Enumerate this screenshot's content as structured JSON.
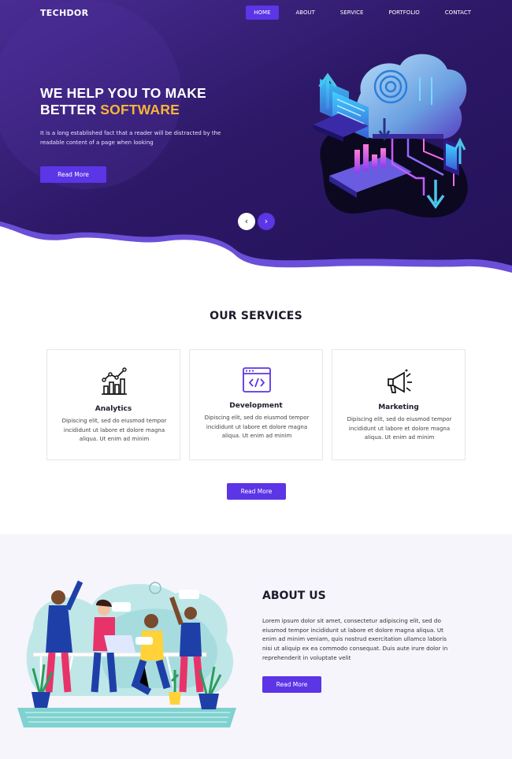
{
  "nav": {
    "logo": "TECHDOR",
    "items": [
      {
        "label": "HOME",
        "active": true
      },
      {
        "label": "ABOUT",
        "active": false
      },
      {
        "label": "SERVICE",
        "active": false
      },
      {
        "label": "PORTFOLIO",
        "active": false
      },
      {
        "label": "CONTACT",
        "active": false
      }
    ]
  },
  "hero": {
    "title_line1": "WE HELP YOU TO MAKE",
    "title_line2_prefix": "BETTER ",
    "title_line2_accent": "SOFTWARE",
    "text": "It is a long established fact that a reader will be distracted by the readable content of a page when looking",
    "button": "Read More",
    "prev_icon": "‹",
    "next_icon": "›"
  },
  "services": {
    "title": "OUR SERVICES",
    "cards": [
      {
        "icon": "analytics-chart-icon",
        "title": "Analytics",
        "desc": "Dipiscing elit, sed do eiusmod tempor incididunt ut labore et dolore magna aliqua. Ut enim ad minim"
      },
      {
        "icon": "code-window-icon",
        "title": "Development",
        "desc": "Dipiscing elit, sed do eiusmod tempor incididunt ut labore et dolore magna aliqua. Ut enim ad minim"
      },
      {
        "icon": "megaphone-icon",
        "title": "Marketing",
        "desc": "Dipiscing elit, sed do eiusmod tempor incididunt ut labore et dolore magna aliqua. Ut enim ad minim"
      }
    ],
    "button": "Read More"
  },
  "about": {
    "title": "ABOUT US",
    "text": "Lorem ipsum dolor sit amet, consectetur adipiscing elit, sed do eiusmod tempor incididunt ut labore et dolore magna aliqua. Ut enim ad minim veniam, quis nostrud exercitation ullamco laboris nisi ut aliquip ex ea commodo consequat. Duis aute irure dolor in reprehenderit in voluptate velit",
    "button": "Read More"
  },
  "colors": {
    "hero_dark": "#2a1760",
    "hero_light": "#4b2c9a",
    "accent": "#5b35e6",
    "highlight": "#f7b538",
    "wave": "#6b4fd8"
  }
}
